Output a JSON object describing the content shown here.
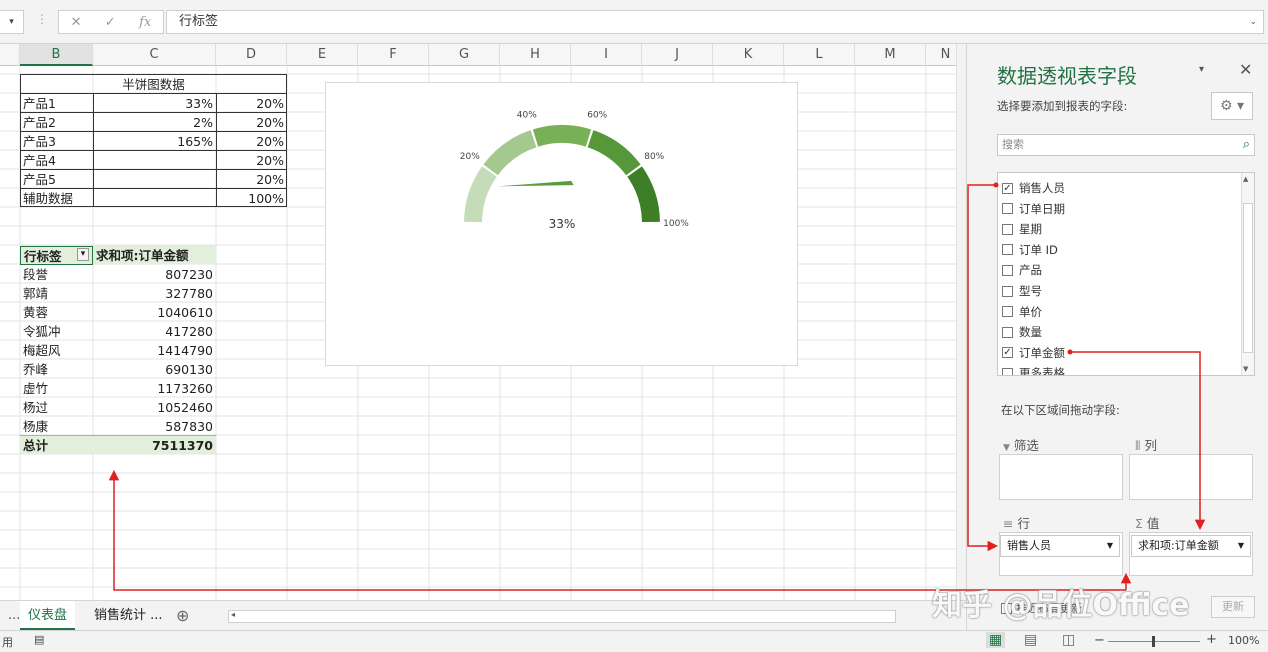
{
  "formula_bar": {
    "name_box": "▾",
    "cancel": "✕",
    "enter": "✓",
    "fx": "fx",
    "value": "行标签"
  },
  "columns": [
    "B",
    "C",
    "D",
    "E",
    "F",
    "G",
    "H",
    "I",
    "J",
    "K",
    "L",
    "M",
    "N"
  ],
  "halfpie": {
    "title": "半饼图数据",
    "rows": [
      {
        "label": "产品1",
        "c": "33%",
        "d": "20%"
      },
      {
        "label": "产品2",
        "c": "2%",
        "d": "20%"
      },
      {
        "label": "产品3",
        "c": "165%",
        "d": "20%"
      },
      {
        "label": "产品4",
        "c": "",
        "d": "20%"
      },
      {
        "label": "产品5",
        "c": "",
        "d": "20%"
      },
      {
        "label": "辅助数据",
        "c": "",
        "d": "100%"
      }
    ]
  },
  "pivot": {
    "header_label": "行标签",
    "header_value": "求和项:订单金额",
    "rows": [
      {
        "name": "段誉",
        "value": "807230"
      },
      {
        "name": "郭靖",
        "value": "327780"
      },
      {
        "name": "黄蓉",
        "value": "1040610"
      },
      {
        "name": "令狐冲",
        "value": "417280"
      },
      {
        "name": "梅超风",
        "value": "1414790"
      },
      {
        "name": "乔峰",
        "value": "690130"
      },
      {
        "name": "虚竹",
        "value": "1173260"
      },
      {
        "name": "杨过",
        "value": "1052460"
      },
      {
        "name": "杨康",
        "value": "587830"
      }
    ],
    "total_label": "总计",
    "total_value": "7511370"
  },
  "chart_data": {
    "type": "pie",
    "ticks": [
      "20%",
      "40%",
      "60%",
      "80%",
      "100%"
    ],
    "value_label": "33%",
    "value": 0.33,
    "segment_colors": [
      "#c5dcb8",
      "#a3c98f",
      "#78b058",
      "#56973a",
      "#3d7f27"
    ]
  },
  "tabs": {
    "more": "...",
    "active": "仪表盘",
    "other": "销售统计 ...",
    "add": "⊕"
  },
  "status": {
    "ready": "用",
    "zoom": "100%",
    "minus": "−",
    "plus": "+"
  },
  "pane": {
    "title": "数据透视表字段",
    "subtitle": "选择要添加到报表的字段:",
    "search_placeholder": "搜索",
    "fields": [
      {
        "name": "销售人员",
        "checked": "✓"
      },
      {
        "name": "订单日期",
        "checked": ""
      },
      {
        "name": "星期",
        "checked": ""
      },
      {
        "name": "订单 ID",
        "checked": ""
      },
      {
        "name": "产品",
        "checked": ""
      },
      {
        "name": "型号",
        "checked": ""
      },
      {
        "name": "单价",
        "checked": ""
      },
      {
        "name": "数量",
        "checked": ""
      },
      {
        "name": "订单金额",
        "checked": "✓"
      },
      {
        "name": "更多表格...",
        "checked": ""
      }
    ],
    "drag_hint": "在以下区域间拖动字段:",
    "filter": "筛选",
    "columns": "列",
    "rows": "行",
    "values": "值",
    "row_item": "销售人员",
    "value_item": "求和项:订单金额",
    "defer": "推迟布局更新",
    "update": "更新",
    "icons": {
      "filter": "▼",
      "columns": "⦀",
      "rows": "≡",
      "values": "Σ"
    }
  },
  "watermark": "知乎 @品位Office"
}
